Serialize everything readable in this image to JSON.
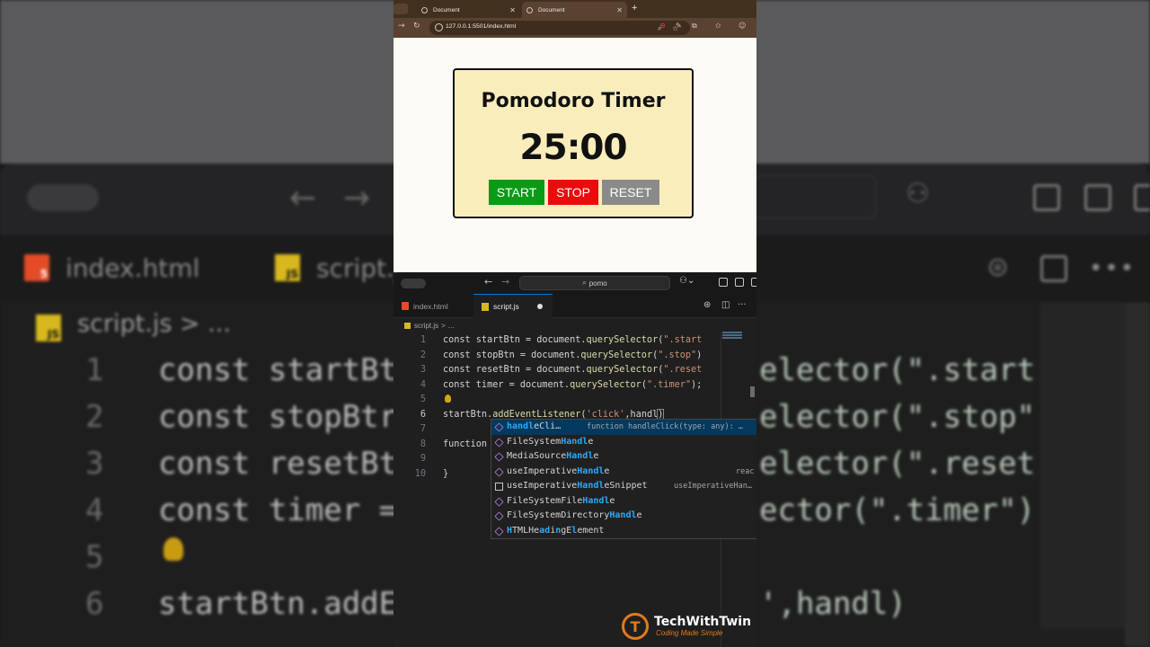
{
  "browser": {
    "tabs": [
      {
        "title": "Document",
        "active": false
      },
      {
        "title": "Document",
        "active": true
      }
    ],
    "new_tab_symbol": "+",
    "url": "127.0.0.1:5501/index.html"
  },
  "timer_app": {
    "title": "Pomodoro Timer",
    "time": "25:00",
    "buttons": {
      "start": "START",
      "stop": "STOP",
      "reset": "RESET"
    },
    "colors": {
      "card": "#f9edbb",
      "start": "#0a9a16",
      "stop": "#ea0c0c",
      "reset": "#8a8a8a"
    }
  },
  "editor": {
    "search": "pomo",
    "tabs": [
      {
        "label": "index.html",
        "icon": "html-file-icon"
      },
      {
        "label": "script.js",
        "icon": "js-file-icon",
        "active": true,
        "modified": true
      }
    ],
    "breadcrumb": {
      "file": "script.js",
      "separator": ">",
      "more": "..."
    },
    "lines": [
      {
        "n": "1",
        "parts": [
          [
            "k",
            "const startBtn = document."
          ],
          [
            "f",
            "querySelector"
          ],
          [
            "k",
            "("
          ],
          [
            "s",
            "\".start"
          ]
        ]
      },
      {
        "n": "2",
        "parts": [
          [
            "k",
            "const stopBtn = document."
          ],
          [
            "f",
            "querySelector"
          ],
          [
            "k",
            "("
          ],
          [
            "s",
            "\".stop\""
          ],
          [
            "k",
            ")"
          ]
        ]
      },
      {
        "n": "3",
        "parts": [
          [
            "k",
            "const resetBtn = document."
          ],
          [
            "f",
            "querySelector"
          ],
          [
            "k",
            "("
          ],
          [
            "s",
            "\".reset"
          ]
        ]
      },
      {
        "n": "4",
        "parts": [
          [
            "k",
            "const timer = document."
          ],
          [
            "f",
            "querySelector"
          ],
          [
            "k",
            "("
          ],
          [
            "s",
            "\".timer\""
          ],
          [
            "k",
            ");"
          ]
        ]
      },
      {
        "n": "5",
        "parts": []
      },
      {
        "n": "6",
        "parts": [
          [
            "k",
            "startBtn."
          ],
          [
            "f",
            "addEventListener"
          ],
          [
            "k",
            "("
          ],
          [
            "s",
            "'click'"
          ],
          [
            "k",
            ",handl"
          ],
          [
            "br",
            ")"
          ]
        ],
        "current": true
      },
      {
        "n": "7",
        "parts": []
      },
      {
        "n": "8",
        "parts": [
          [
            "k",
            "function"
          ]
        ]
      },
      {
        "n": "9",
        "parts": []
      },
      {
        "n": "10",
        "parts": [
          [
            "k",
            "}"
          ]
        ]
      }
    ],
    "suggestions": [
      {
        "label": "handleCli…",
        "match": "handl",
        "icon": "cube",
        "detail": "function handleClick(type: any): …",
        "selected": true
      },
      {
        "label": "FileSystemHandle",
        "match": "Handl",
        "icon": "cube"
      },
      {
        "label": "MediaSourceHandle",
        "match": "Handl",
        "icon": "cube"
      },
      {
        "label": "useImperativeHandle",
        "match": "Handl",
        "icon": "cube",
        "detail": "reac"
      },
      {
        "label": "useImperativeHandleSnippet",
        "match": "Handl",
        "icon": "square",
        "detail": "useImperativeHan…"
      },
      {
        "label": "FileSystemFileHandle",
        "match": "Handl",
        "icon": "cube"
      },
      {
        "label": "FileSystemDirectoryHandle",
        "match": "Handl",
        "icon": "cube"
      },
      {
        "label": "HTMLHeadingElement",
        "match": "",
        "icon": "cube"
      }
    ]
  },
  "background": {
    "tabs": [
      "index.html",
      "script.js"
    ],
    "breadcrumb": "script.js > ...",
    "lines": [
      {
        "n": "1",
        "code": "const startBt",
        "right": "elector(\".start"
      },
      {
        "n": "2",
        "code": "const stopBtr",
        "right": "elector(\".stop\")"
      },
      {
        "n": "3",
        "code": "const resetBtn",
        "right": "elector(\".reset"
      },
      {
        "n": "4",
        "code": "const timer =",
        "right": "ector(\".timer\");"
      },
      {
        "n": "5",
        "code": "",
        "right": ""
      },
      {
        "n": "6",
        "code": "startBtn.addE",
        "right": "',handl)"
      }
    ]
  },
  "watermark": {
    "name": "TechWithTwin",
    "tagline": "Coding Made Simple",
    "logo_letter": "T",
    "color": "#e37a1a"
  }
}
